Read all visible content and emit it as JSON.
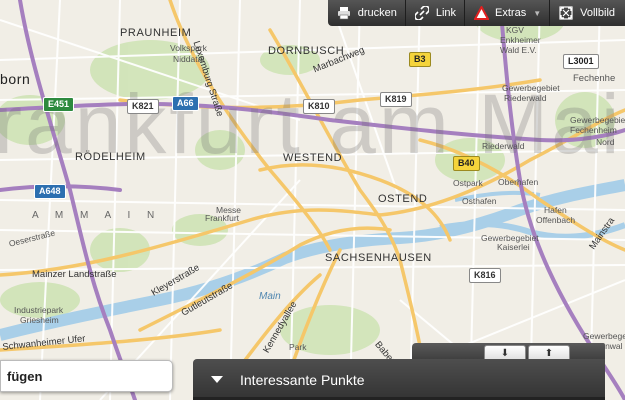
{
  "toolbar": {
    "print_label": "drucken",
    "link_label": "Link",
    "extras_label": "Extras",
    "fullscreen_label": "Vollbild"
  },
  "map": {
    "city_watermark": "rankfurt am Mai",
    "river_main_label": "A M   M A I N",
    "river_label": "Main",
    "districts": {
      "praunheim": "PRAUNHEIM",
      "dornbusch": "DORNBUSCH",
      "roedelheim": "RÖDELHEIM",
      "westend": "WESTEND",
      "ostend": "OSTEND",
      "sachsenhausen": "SACHSENHAUSEN",
      "bockenheim_partial": "born"
    },
    "places": {
      "volkspark": "Volkspark",
      "niddatal": "Niddatal",
      "messe": "Messe",
      "frankfurt": "Frankfurt",
      "ostpark": "Ostpark",
      "osthafen": "Osthafen",
      "oberhafen": "Oberhafen",
      "hafen": "Hafen",
      "offenbach": "Offenbach",
      "gewerbegebiet": "Gewerbegebiet",
      "kaiserlei": "Kaiserlei",
      "riederwald": "Riederwald",
      "gewerbegebiet_riederwald": "Gewerbegebiet",
      "riederwald2": "Riederwald",
      "kgv": "KGV",
      "enkheimer": "Enkheimer",
      "wald_ev": "Wald E.V.",
      "fechenheim": "Fechenhe",
      "gewerbegebiet_fech": "Gewerbegebiet",
      "fechenheim_nord": "Fechenheim",
      "nord": "Nord",
      "industriepark": "Industriepark",
      "griesheim": "Griesheim",
      "park": "Park",
      "gewerbegebiet_sued": "Gewerbegebiet",
      "odenwald": "Odenwal"
    },
    "streets": {
      "luxemburger": "Luxemburg Straße",
      "marbachweg": "Marbachweg",
      "oeserstrasse": "Oeserstraße",
      "mainzer": "Mainzer Landstraße",
      "kleyerstrasse": "Kleyerstraße",
      "gutleutstrasse": "Gutleutstraße",
      "schwanheimer": "Schwanheimer Ufer",
      "kennedyallee": "Kennedyallee",
      "mainstrasse": "Mainstra",
      "babenhaeuser": "Babenh"
    },
    "shields": {
      "b3": "B3",
      "k810": "K810",
      "k819": "K819",
      "k821": "K821",
      "a66": "A66",
      "e451": "E451",
      "a648": "A648",
      "b40": "B40",
      "k816": "K816",
      "l3001": "L3001"
    },
    "colors": {
      "background": "#f1eee6",
      "major_road": "#f5c76a",
      "motorway": "#a57fbf",
      "water": "#a9cfe8",
      "park": "#cfe3b6"
    }
  },
  "bottom": {
    "left_button_label": "fügen",
    "poi_label": "Interessante Punkte"
  }
}
